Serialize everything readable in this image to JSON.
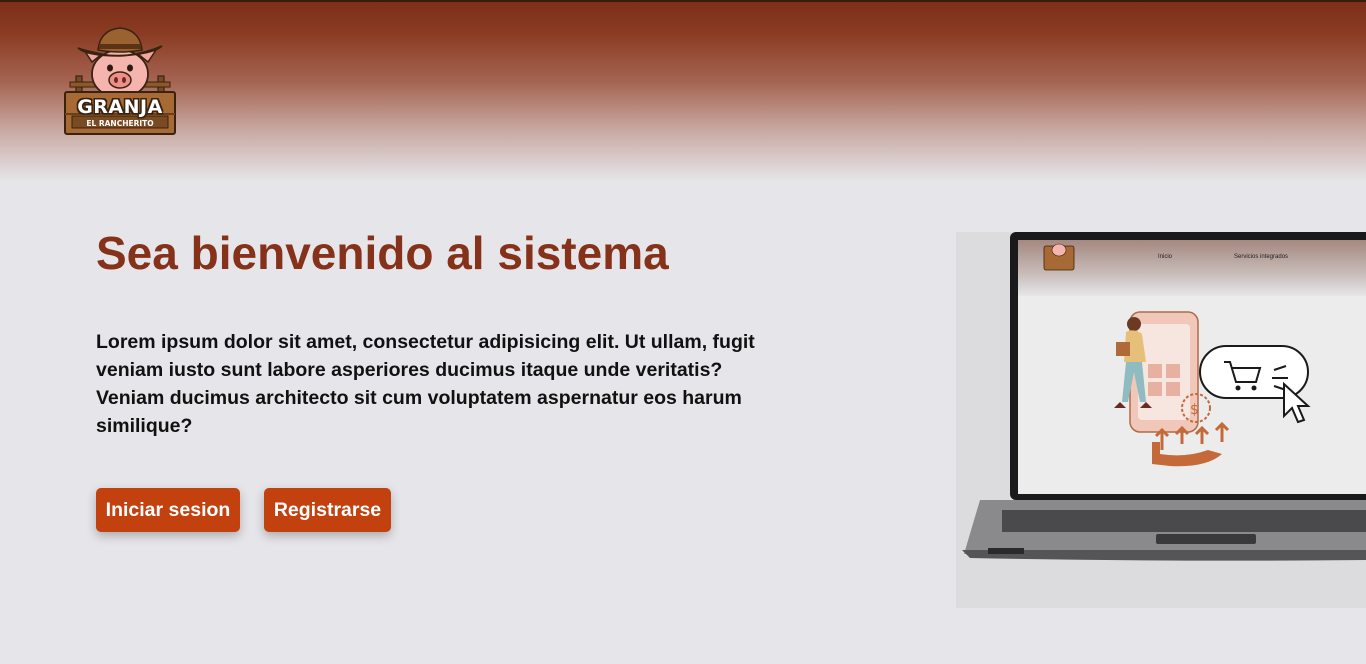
{
  "header": {
    "logo": {
      "brand_name": "GRANJA",
      "brand_sub": "EL RANCHERITO",
      "icon": "pig-cowboy-logo-icon"
    }
  },
  "hero": {
    "title": "Sea bienvenido al sistema",
    "description": "Lorem ipsum dolor sit amet, consectetur adipisicing elit. Ut ullam, fugit veniam iusto sunt labore asperiores ducimus itaque unde veritatis? Veniam ducimus architecto sit cum voluptatem aspernatur eos harum similique?",
    "buttons": {
      "login_label": "Iniciar sesion",
      "register_label": "Registrarse"
    }
  },
  "illustration": {
    "icon": "laptop-shopping-illustration",
    "screen_nav": {
      "item1": "Inicio",
      "item2": "Servicios integrados"
    }
  },
  "colors": {
    "header_dark": "#7c2e17",
    "title": "#86321b",
    "button": "#c2410f",
    "background": "#e6e6ea"
  }
}
